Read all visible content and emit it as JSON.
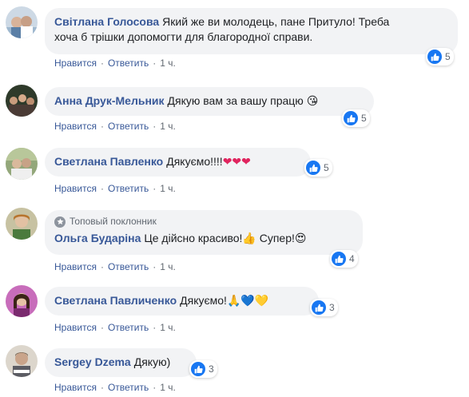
{
  "ui": {
    "like_label": "Нравится",
    "reply_label": "Ответить",
    "dot": "·"
  },
  "comments": [
    {
      "author": "Світлана Голосова",
      "text_line1": "Який же ви молодець, пане Притуло! Треба",
      "text_line2": "хоча б трішки допомогти для благородної справи.",
      "reactions": "5",
      "time": "1 ч."
    },
    {
      "author": "Анна Друк-Мельник",
      "text": "Дякую вам за вашу працю",
      "emoji": "😘",
      "reactions": "5",
      "time": "1 ч."
    },
    {
      "author": "Светлана Павленко",
      "text": "Дякуємо!!!!",
      "emoji": "❤❤❤",
      "reactions": "5",
      "time": "1 ч."
    },
    {
      "badge": "Топовый поклонник",
      "author": "Ольга Бударіна",
      "text": "Це дійсно красиво!",
      "emoji1": "👍",
      "text2": " Супер!",
      "emoji2": "😍",
      "reactions": "4",
      "time": "1 ч."
    },
    {
      "author": "Светлана Павличенко",
      "text": "Дякуємо!",
      "emoji": "🙏💙💛",
      "reactions": "3",
      "time": "1 ч."
    },
    {
      "author": "Sergey Dzema",
      "text": "Дякую)",
      "reactions": "3",
      "time": "1 ч."
    }
  ],
  "colors": {
    "author": "#385898",
    "bubble": "#f2f3f5",
    "like": "#1877f2",
    "meta": "#606770"
  },
  "icons": {
    "like": "thumbs-up-icon",
    "badge": "star-icon"
  }
}
